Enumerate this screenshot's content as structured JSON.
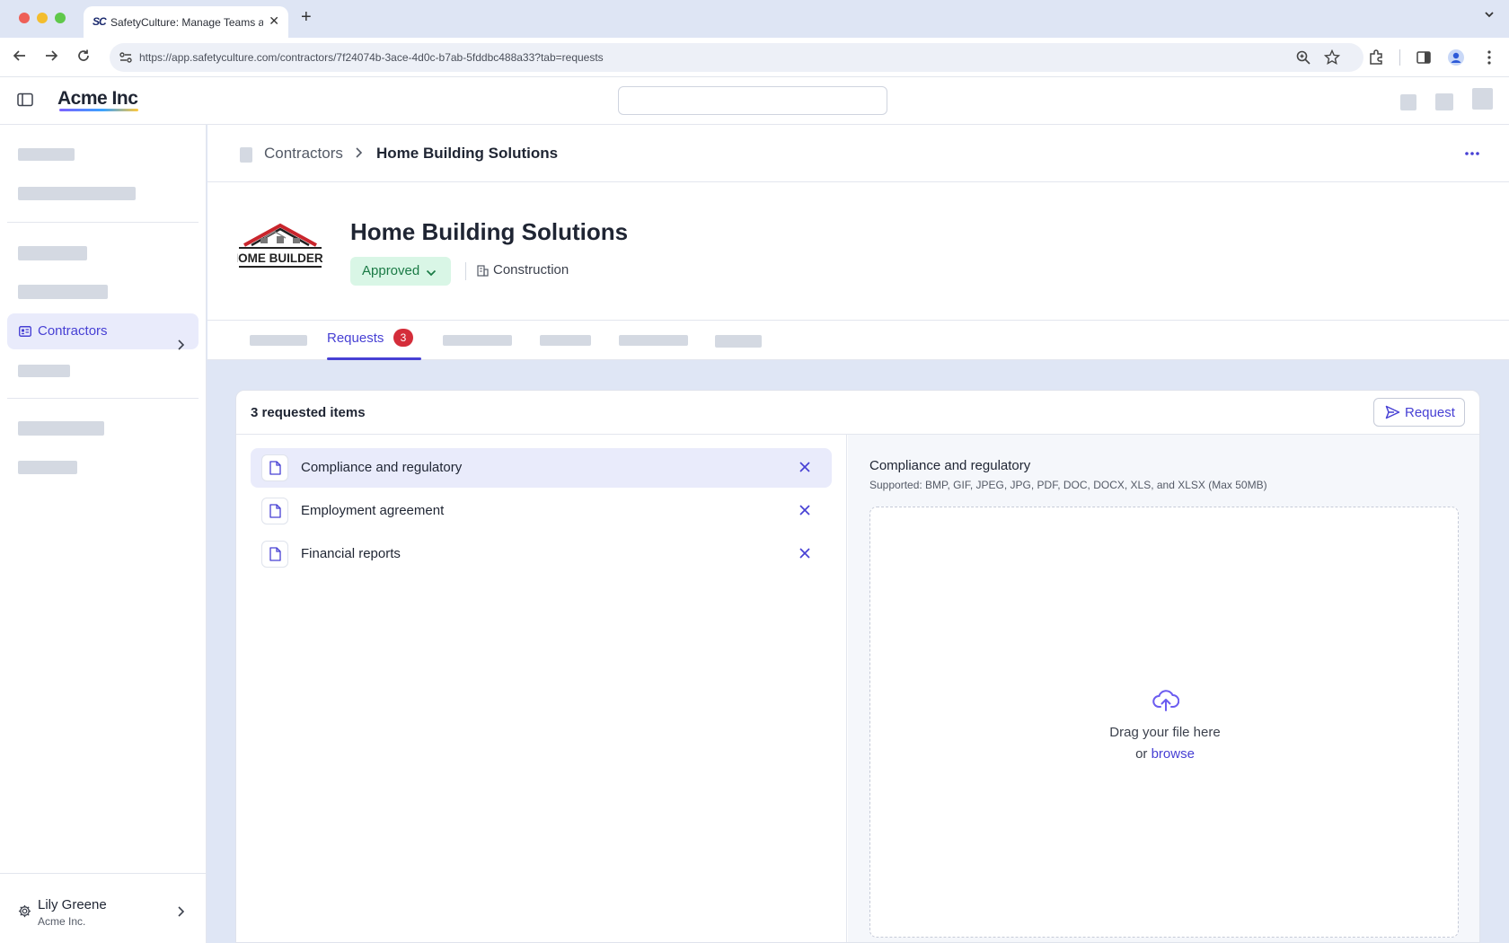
{
  "browser": {
    "tab_title": "SafetyCulture: Manage Teams and...",
    "favicon_text": "SC",
    "url": "https://app.safetyculture.com/contractors/7f24074b-3ace-4d0c-b7ab-5fddbc488a33?tab=requests"
  },
  "header": {
    "brand": "Acme Inc"
  },
  "sidebar": {
    "active_item": "Contractors",
    "user": {
      "name": "Lily Greene",
      "org": "Acme Inc."
    }
  },
  "breadcrumb": {
    "parent": "Contractors",
    "current": "Home Building Solutions"
  },
  "contractor": {
    "name": "Home Building Solutions",
    "logo_text": "HOME BUILDERS",
    "status": "Approved",
    "industry": "Construction"
  },
  "tabs": {
    "active_label": "Requests",
    "active_count": "3"
  },
  "requests": {
    "heading": "3 requested items",
    "request_button": "Request",
    "items": [
      {
        "label": "Compliance and regulatory",
        "selected": true
      },
      {
        "label": "Employment agreement",
        "selected": false
      },
      {
        "label": "Financial reports",
        "selected": false
      }
    ]
  },
  "detail": {
    "title": "Compliance and regulatory",
    "supported": "Supported: BMP, GIF, JPEG, JPG, PDF, DOC, DOCX, XLS, and XLSX (Max 50MB)",
    "drop_text": "Drag your file here",
    "or_text": "or",
    "browse_text": "browse"
  },
  "colors": {
    "accent": "#4740d4",
    "approved_bg": "#d9f6e6",
    "approved_text": "#1a7a45",
    "badge": "#d42d3a"
  }
}
